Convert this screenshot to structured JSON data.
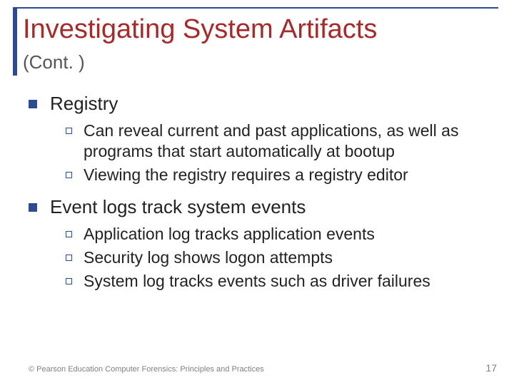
{
  "title": "Investigating System Artifacts",
  "subtitle": "(Cont. )",
  "bullets": [
    {
      "text": "Registry",
      "sub": [
        "Can reveal current and past applications, as well as programs that start automatically at bootup",
        "Viewing the registry requires a registry editor"
      ]
    },
    {
      "text": "Event logs track system events",
      "sub": [
        "Application log tracks application events",
        "Security log shows logon attempts",
        "System log tracks events such as driver failures"
      ]
    }
  ],
  "footer_left": "© Pearson Education  Computer Forensics: Principles and Practices",
  "footer_right": "17"
}
